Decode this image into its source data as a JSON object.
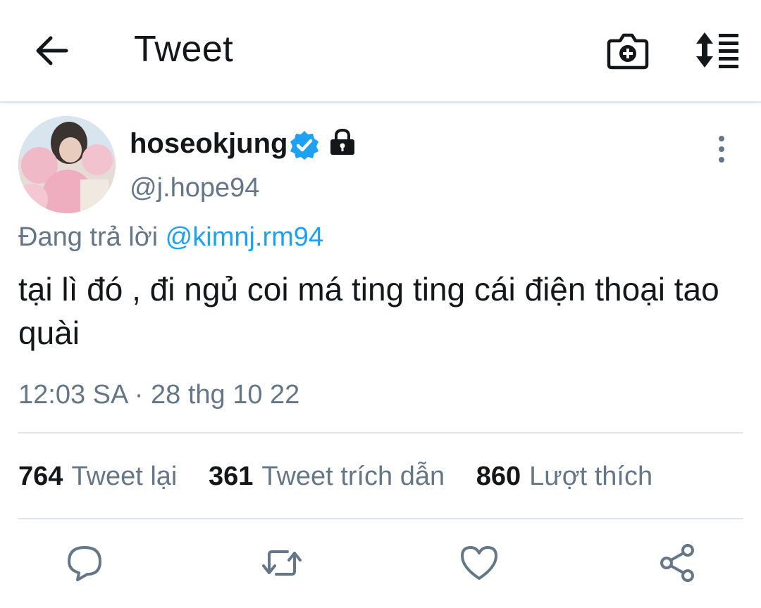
{
  "header": {
    "title": "Tweet",
    "icons": [
      "back-arrow-icon",
      "camera-add-icon",
      "sort-order-icon"
    ]
  },
  "tweet": {
    "display_name": "hoseokjung",
    "handle": "@j.hope94",
    "verified": true,
    "protected": true,
    "reply_prefix": "Đang trả lời",
    "reply_to": "@kimnj.rm94",
    "text": "tại lì đó , đi ngủ coi má ting ting cái điện thoại tao quài",
    "timestamp": "12:03 SA · 28 thg 10 22",
    "stats": {
      "retweets_count": "764",
      "retweets_label": "Tweet lại",
      "quotes_count": "361",
      "quotes_label": "Tweet trích dẫn",
      "likes_count": "860",
      "likes_label": "Lượt thích"
    }
  },
  "actions": [
    "reply-icon",
    "retweet-icon",
    "like-icon",
    "share-icon"
  ],
  "colors": {
    "link": "#1da1f2",
    "secondary_text": "#657786",
    "primary_text": "#14171a",
    "divider": "#e1e4e6"
  }
}
